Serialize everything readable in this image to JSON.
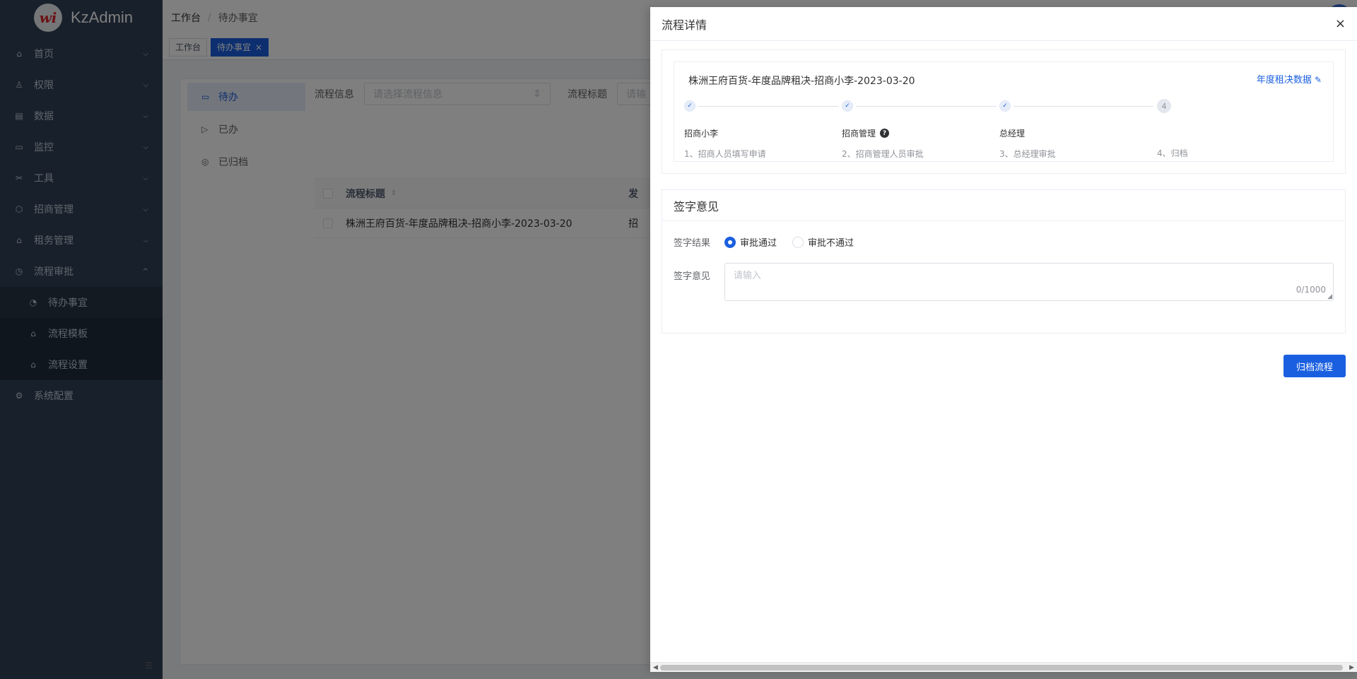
{
  "app": {
    "name": "KzAdmin",
    "logo_glyph": "wi"
  },
  "sidebar": {
    "items": [
      {
        "label": "首页",
        "icon": "home-icon"
      },
      {
        "label": "权限",
        "icon": "user-lock-icon"
      },
      {
        "label": "数据",
        "icon": "database-icon"
      },
      {
        "label": "监控",
        "icon": "monitor-icon"
      },
      {
        "label": "工具",
        "icon": "tools-icon"
      },
      {
        "label": "招商管理",
        "icon": "box-icon"
      },
      {
        "label": "租务管理",
        "icon": "building-icon"
      },
      {
        "label": "流程审批",
        "icon": "history-icon"
      }
    ],
    "sub_items": [
      {
        "label": "待办事宜",
        "icon": "todo-icon",
        "active": true
      },
      {
        "label": "流程模板",
        "icon": "home-icon"
      },
      {
        "label": "流程设置",
        "icon": "home-icon"
      }
    ],
    "last_item": {
      "label": "系统配置",
      "icon": "gear-icon"
    }
  },
  "breadcrumb": {
    "root": "工作台",
    "sep": "/",
    "current": "待办事宜"
  },
  "tags": [
    {
      "label": "工作台",
      "active": false
    },
    {
      "label": "待办事宜",
      "active": true,
      "close": "×"
    }
  ],
  "main": {
    "side_tabs": [
      {
        "label": "待办",
        "icon": "calendar-icon",
        "active": true
      },
      {
        "label": "已办",
        "icon": "send-icon",
        "active": false
      },
      {
        "label": "已归档",
        "icon": "archive-icon",
        "active": false
      }
    ],
    "filters": {
      "flow_info_label": "流程信息",
      "flow_info_placeholder": "请选择流程信息",
      "flow_title_label": "流程标题",
      "flow_title_placeholder": "请输"
    },
    "table": {
      "col_title": "流程标题",
      "col_next": "发",
      "rows": [
        {
          "title": "株洲王府百货-年度品牌租决-招商小李-2023-03-20",
          "next": "招"
        }
      ]
    }
  },
  "drawer": {
    "title": "流程详情",
    "close": "×",
    "flow": {
      "title": "株洲王府百货-年度品牌租决-招商小李-2023-03-20",
      "link": "年度租决数据",
      "steps": [
        {
          "status": "done",
          "mark": "✓",
          "name": "招商小李",
          "desc": "1、招商人员填写申请",
          "help": false
        },
        {
          "status": "done",
          "mark": "✓",
          "name": "招商管理",
          "desc": "2、招商管理人员审批",
          "help": true
        },
        {
          "status": "done",
          "mark": "✓",
          "name": "总经理",
          "desc": "3、总经理审批",
          "help": false
        },
        {
          "status": "pending",
          "mark": "4",
          "name": "",
          "desc": "4、归档",
          "help": false
        }
      ],
      "help_glyph": "?"
    },
    "sign": {
      "title": "签字意见",
      "result_label": "签字结果",
      "options": [
        {
          "label": "审批通过",
          "checked": true
        },
        {
          "label": "审批不通过",
          "checked": false
        }
      ],
      "opinion_label": "签字意见",
      "opinion_placeholder": "请输入",
      "opinion_value": "",
      "count": "0/1000"
    },
    "archive_button": "归档流程"
  },
  "colors": {
    "primary": "#1a5fe0",
    "sidebar_bg": "#304156",
    "overlay": "rgba(0,0,0,0.5)"
  }
}
